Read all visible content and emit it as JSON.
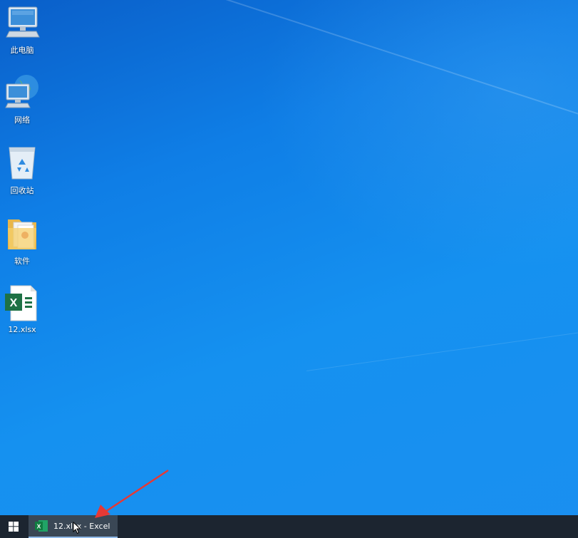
{
  "desktop": {
    "icons": [
      {
        "label": "此电脑",
        "icon": "this-pc-icon"
      },
      {
        "label": "网络",
        "icon": "network-icon"
      },
      {
        "label": "回收站",
        "icon": "recycle-bin-icon"
      },
      {
        "label": "软件",
        "icon": "folder-icon"
      },
      {
        "label": "12.xlsx",
        "icon": "excel-file-icon"
      }
    ]
  },
  "taskbar": {
    "start_icon": "windows-start-icon",
    "items": [
      {
        "label": "12.xlsx - Excel",
        "icon": "excel-icon",
        "active": true
      }
    ]
  },
  "colors": {
    "desktop_background": "#1a8ff0",
    "taskbar_background": "#1c2530",
    "excel_green": "#1e7145",
    "annotation_arrow": "#e53935"
  }
}
